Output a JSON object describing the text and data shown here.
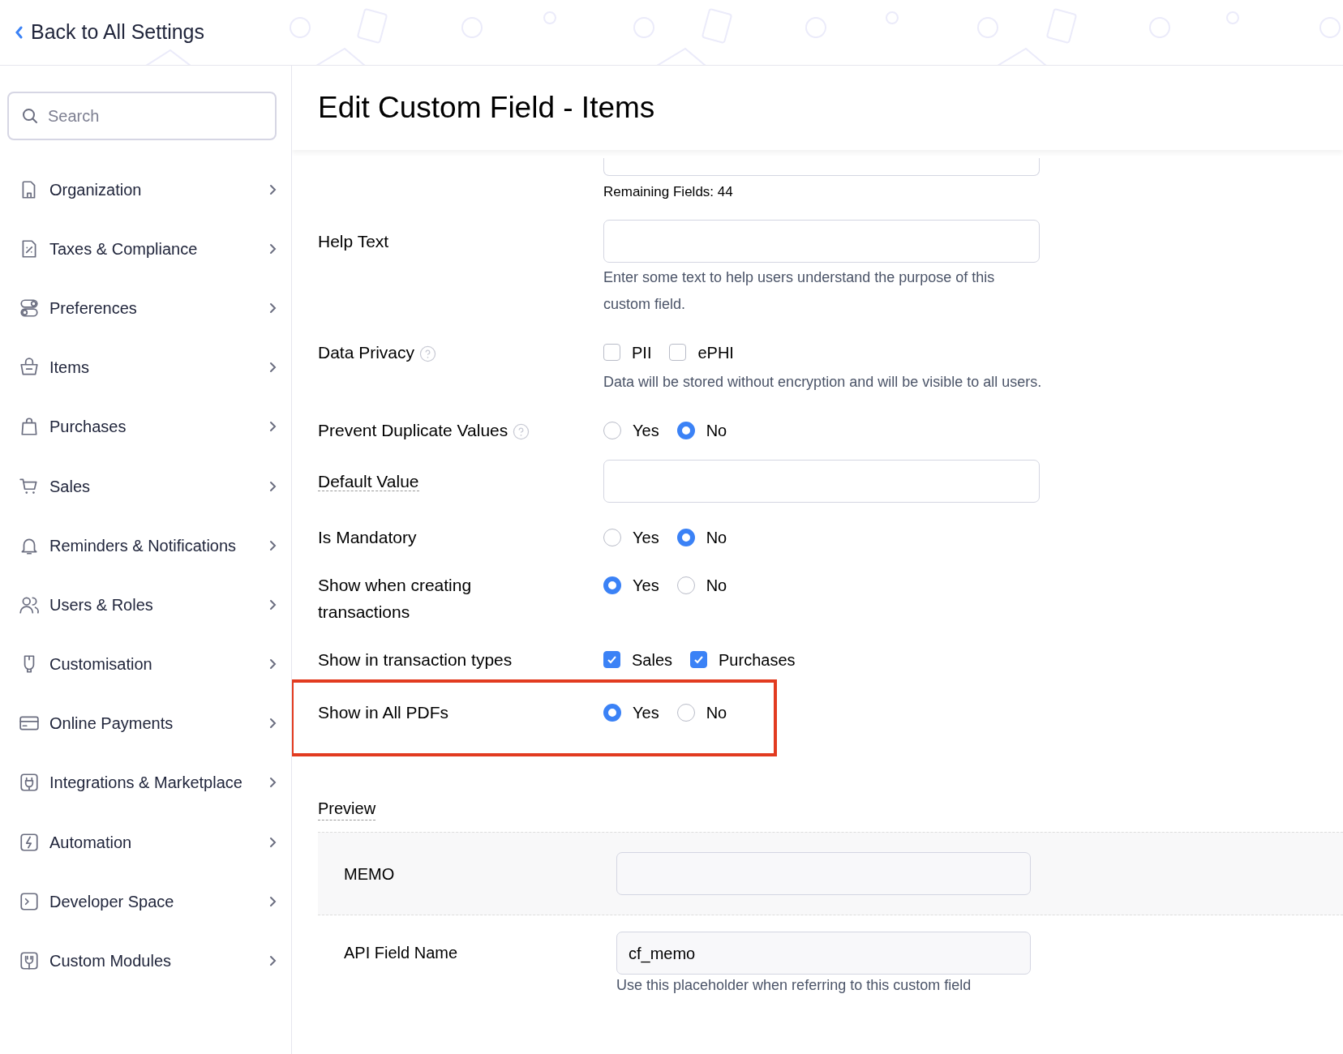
{
  "header": {
    "back_link": "Back to All Settings"
  },
  "sidebar": {
    "search": {
      "placeholder": "Search"
    },
    "items": [
      {
        "label": "Organization"
      },
      {
        "label": "Taxes & Compliance"
      },
      {
        "label": "Preferences"
      },
      {
        "label": "Items"
      },
      {
        "label": "Purchases"
      },
      {
        "label": "Sales"
      },
      {
        "label": "Reminders & Notifications"
      },
      {
        "label": "Users & Roles"
      },
      {
        "label": "Customisation"
      },
      {
        "label": "Online Payments"
      },
      {
        "label": "Integrations & Marketplace"
      },
      {
        "label": "Automation"
      },
      {
        "label": "Developer Space"
      },
      {
        "label": "Custom Modules"
      }
    ]
  },
  "page": {
    "title": "Edit Custom Field - Items"
  },
  "form": {
    "remaining_fields": "Remaining Fields: 44",
    "rows": [
      {
        "kind": "textinput",
        "label": "Help Text",
        "hint": "Enter some text to help users understand the purpose of this custom field."
      },
      {
        "kind": "checkboxes",
        "label": "Data Privacy",
        "help_icon": true,
        "options": [
          {
            "label": "PII",
            "checked": false
          },
          {
            "label": "ePHI",
            "checked": false
          }
        ],
        "hint": "Data will be stored without encryption and will be visible to all users."
      },
      {
        "kind": "radio",
        "label": "Prevent Duplicate Values",
        "help_icon": true,
        "options": [
          {
            "label": "Yes",
            "selected": false
          },
          {
            "label": "No",
            "selected": true
          }
        ]
      },
      {
        "kind": "textinput",
        "label": "Default Value",
        "underlined": true
      },
      {
        "kind": "radio",
        "label": "Is Mandatory",
        "options": [
          {
            "label": "Yes",
            "selected": false
          },
          {
            "label": "No",
            "selected": true
          }
        ]
      },
      {
        "kind": "radio",
        "label": "Show when creating transactions",
        "options": [
          {
            "label": "Yes",
            "selected": true
          },
          {
            "label": "No",
            "selected": false
          }
        ]
      },
      {
        "kind": "checkboxes",
        "label": "Show in transaction types",
        "options": [
          {
            "label": "Sales",
            "checked": true
          },
          {
            "label": "Purchases",
            "checked": true
          }
        ]
      },
      {
        "kind": "radio",
        "label": "Show in All PDFs",
        "highlighted": true,
        "options": [
          {
            "label": "Yes",
            "selected": true
          },
          {
            "label": "No",
            "selected": false
          }
        ]
      }
    ]
  },
  "preview": {
    "title": "Preview",
    "field_label": "MEMO",
    "api_label": "API Field Name",
    "api_value": "cf_memo",
    "api_hint": "Use this placeholder when referring to this custom field"
  }
}
